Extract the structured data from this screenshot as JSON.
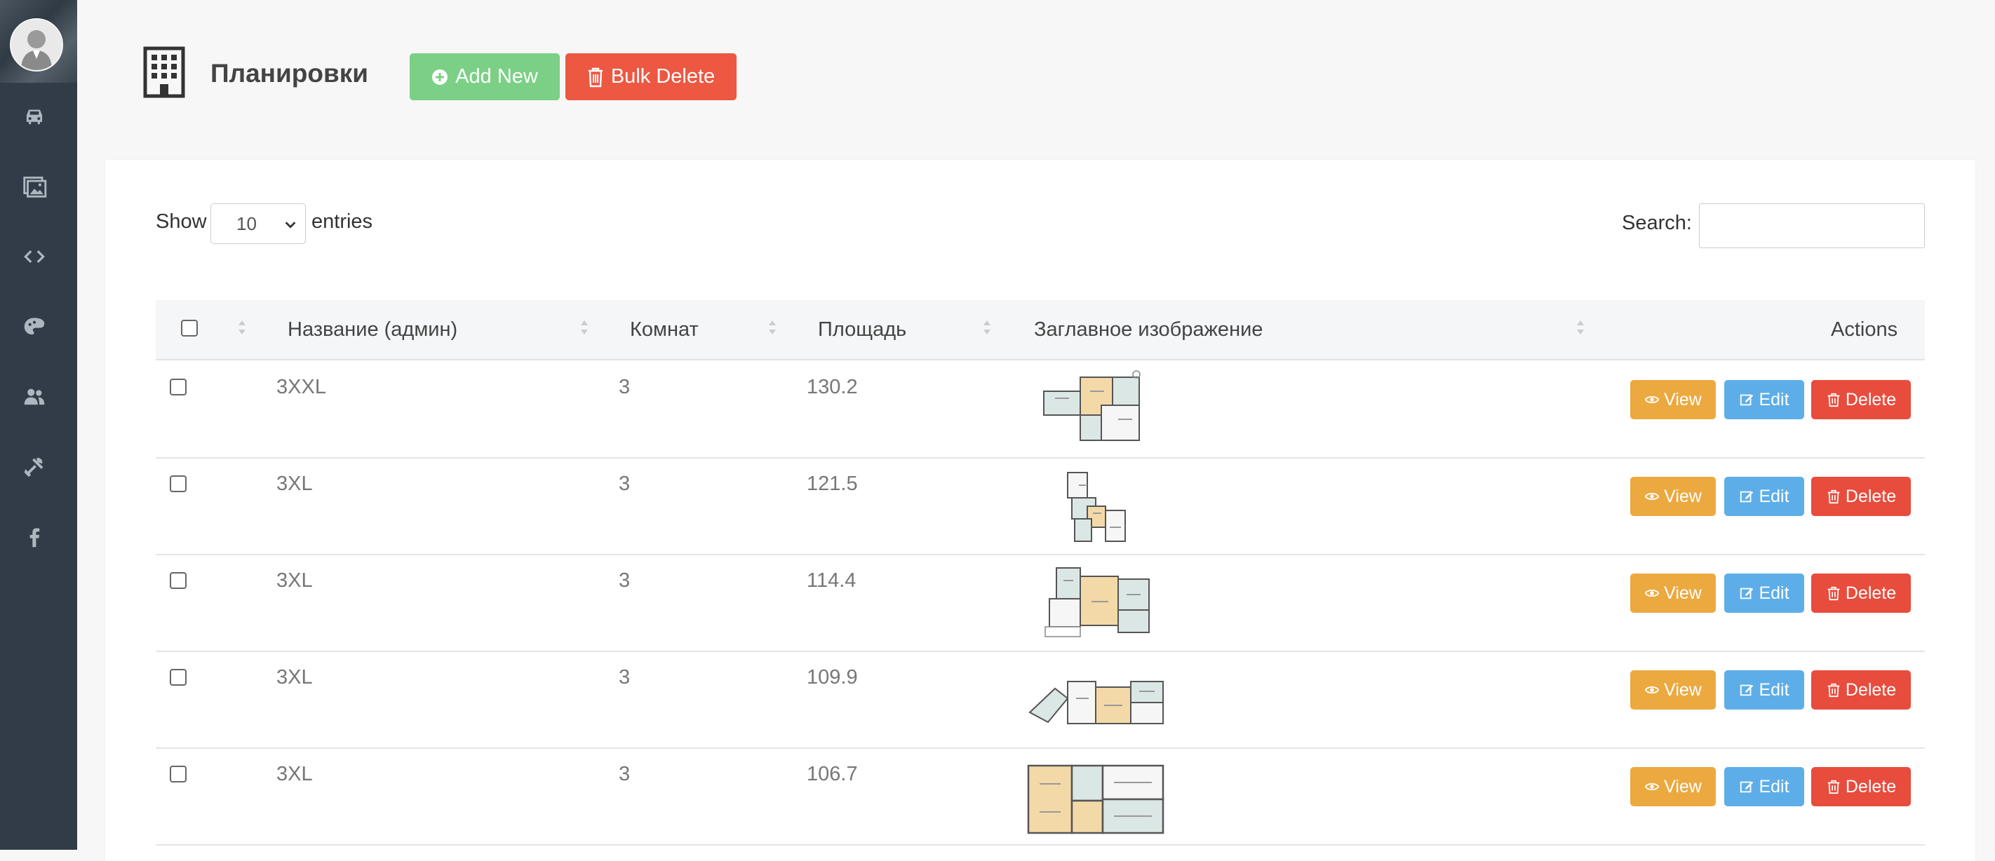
{
  "header": {
    "title": "Планировки",
    "add_new_label": "Add New",
    "bulk_delete_label": "Bulk Delete"
  },
  "sidebar": {
    "items": [
      {
        "icon": "car-icon"
      },
      {
        "icon": "images-icon"
      },
      {
        "icon": "code-icon"
      },
      {
        "icon": "palette-icon"
      },
      {
        "icon": "users-icon"
      },
      {
        "icon": "tools-icon"
      },
      {
        "icon": "facebook-icon"
      }
    ]
  },
  "controls": {
    "show_label": "Show",
    "entries_value": "10",
    "entries_label": "entries",
    "search_label": "Search:",
    "search_value": ""
  },
  "table": {
    "columns": [
      "Название (админ)",
      "Комнат",
      "Площадь",
      "Заглавное изображение",
      "Actions"
    ],
    "actions": {
      "view": "View",
      "edit": "Edit",
      "delete": "Delete"
    },
    "rows": [
      {
        "name": "3XXL",
        "rooms": "3",
        "area": "130.2"
      },
      {
        "name": "3XL",
        "rooms": "3",
        "area": "121.5"
      },
      {
        "name": "3XL",
        "rooms": "3",
        "area": "114.4"
      },
      {
        "name": "3XL",
        "rooms": "3",
        "area": "109.9"
      },
      {
        "name": "3XL",
        "rooms": "3",
        "area": "106.7"
      }
    ]
  },
  "colors": {
    "sidebar": "#323c48",
    "add": "#7bd086",
    "danger": "#e84c3d",
    "view": "#eca940",
    "edit": "#5daee8"
  }
}
